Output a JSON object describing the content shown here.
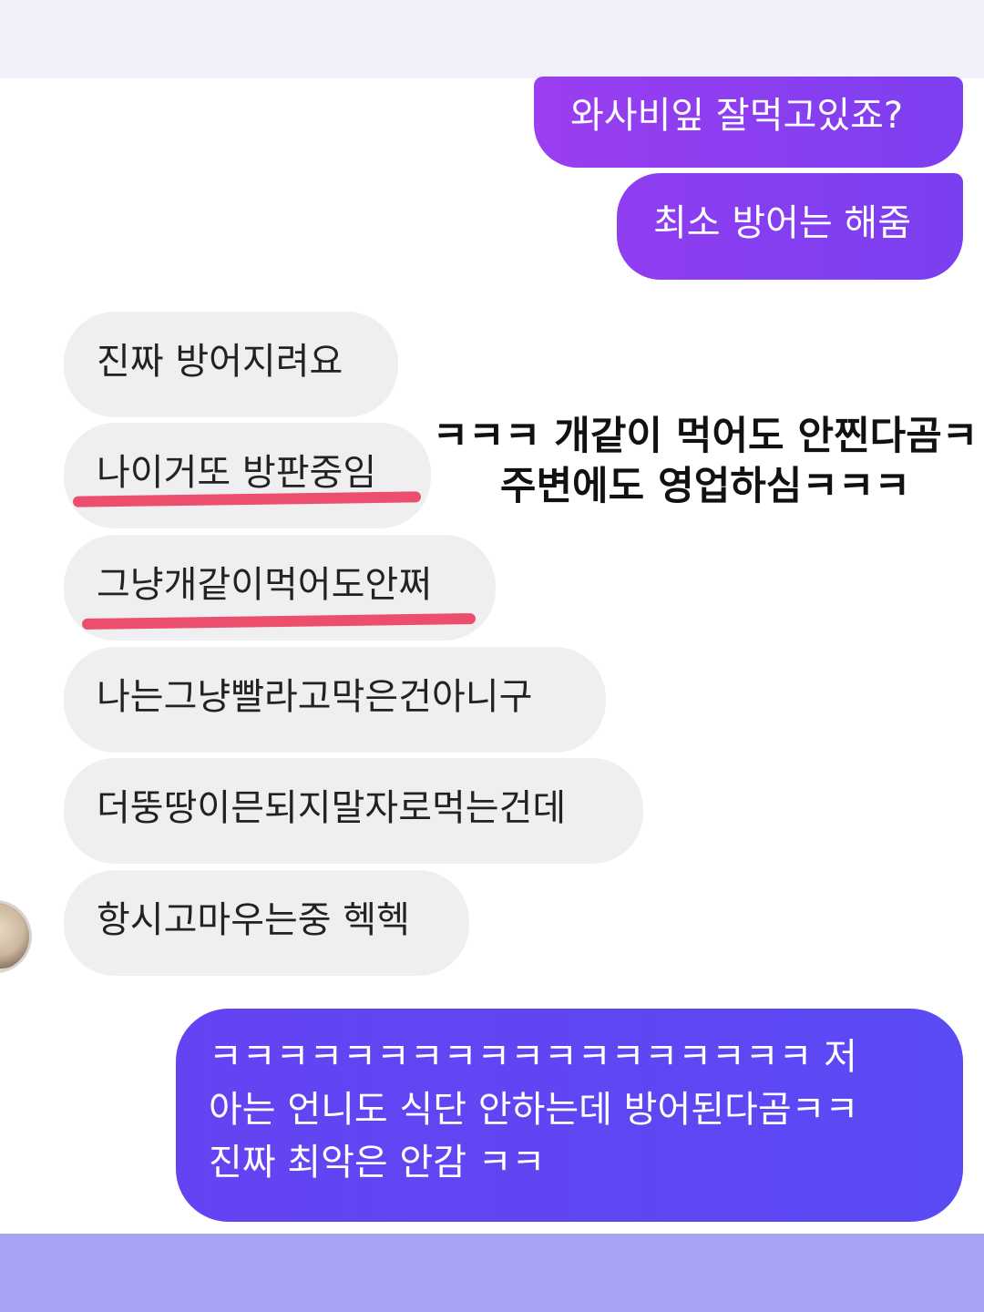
{
  "chat": {
    "sent_messages": [
      {
        "text": "와사비잎 잘먹고있죠?"
      },
      {
        "text": "최소 방어는 해줌"
      }
    ],
    "received_messages": [
      {
        "text": "진짜 방어지려요"
      },
      {
        "text": "나이거또 방판중임"
      },
      {
        "text": "그냥개같이먹어도안쩌"
      },
      {
        "text": "나는그냥빨라고막은건아니구"
      },
      {
        "text": "더뚱땅이믄되지말자로먹는건데"
      },
      {
        "text": "항시고마우는중 헥헥"
      }
    ],
    "reply_message": {
      "lines": [
        "ㅋㅋㅋㅋㅋㅋㅋㅋㅋㅋㅋㅋㅋㅋㅋㅋㅋㅋ 저",
        "아는 언니도 식단 안하는데 방어된다곰ㅋㅋ",
        "진짜 최악은 안감 ㅋㅋ"
      ]
    }
  },
  "overlay_caption": {
    "line1": "ㅋㅋㅋ 개같이 먹어도 안찐다곰ㅋ",
    "line2": "주변에도 영업하심ㅋㅋㅋ"
  },
  "colors": {
    "sent_bubble": "#8a3cf0",
    "reply_bubble": "#5a46f2",
    "received_bubble": "#efeff1",
    "underline": "#ec4f6d",
    "bottom_band": "#a9a3f5"
  }
}
